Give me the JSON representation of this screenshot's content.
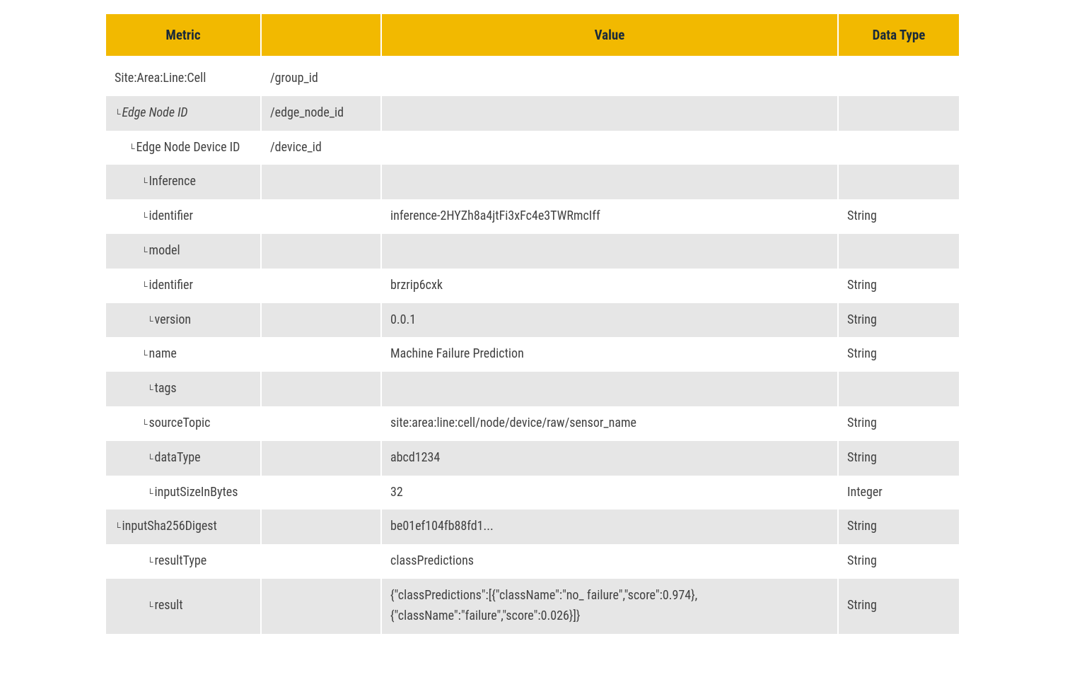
{
  "headers": {
    "metric": "Metric",
    "path": "",
    "value": "Value",
    "datatype": "Data Type"
  },
  "rows": [
    {
      "metric": "Site:Area:Line:Cell",
      "indent": 0,
      "tree": false,
      "italic": false,
      "path": "/group_id",
      "value": "",
      "datatype": "",
      "parity": "odd"
    },
    {
      "metric": "Edge Node ID",
      "indent": 1,
      "tree": true,
      "italic": true,
      "path": "/edge_node_id",
      "value": "",
      "datatype": "",
      "parity": "even"
    },
    {
      "metric": "Edge Node Device ID",
      "indent": 2,
      "tree": true,
      "italic": false,
      "path": "/device_id",
      "value": "",
      "datatype": "",
      "parity": "odd"
    },
    {
      "metric": "Inference",
      "indent": 3,
      "tree": true,
      "italic": false,
      "path": "",
      "value": "",
      "datatype": "",
      "parity": "even"
    },
    {
      "metric": "identifier",
      "indent": 3,
      "tree": true,
      "italic": false,
      "path": "",
      "value": "inference-2HYZh8a4jtFi3xFc4e3TWRmcIff",
      "datatype": "String",
      "parity": "odd"
    },
    {
      "metric": "model",
      "indent": 3,
      "tree": true,
      "italic": false,
      "path": "",
      "value": "",
      "datatype": "",
      "parity": "even"
    },
    {
      "metric": "identifier",
      "indent": 3,
      "tree": true,
      "italic": false,
      "path": "",
      "value": "brzrip6cxk",
      "datatype": "String",
      "parity": "odd"
    },
    {
      "metric": "version",
      "indent": 4,
      "tree": true,
      "italic": false,
      "path": "",
      "value": "0.0.1",
      "datatype": "String",
      "parity": "even"
    },
    {
      "metric": "name",
      "indent": 3,
      "tree": true,
      "italic": false,
      "path": "",
      "value": "Machine Failure Prediction",
      "datatype": "String",
      "parity": "odd"
    },
    {
      "metric": "tags",
      "indent": 4,
      "tree": true,
      "italic": false,
      "path": "",
      "value": "",
      "datatype": "",
      "parity": "even"
    },
    {
      "metric": "sourceTopic",
      "indent": 3,
      "tree": true,
      "italic": false,
      "path": "",
      "value": "site:area:line:cell/node/device/raw/sensor_name",
      "datatype": "String",
      "parity": "odd"
    },
    {
      "metric": "dataType",
      "indent": 4,
      "tree": true,
      "italic": false,
      "path": "",
      "value": "abcd1234",
      "datatype": "String",
      "parity": "even"
    },
    {
      "metric": "inputSizeInBytes",
      "indent": 4,
      "tree": true,
      "italic": false,
      "path": "",
      "value": "32",
      "datatype": "Integer",
      "parity": "odd"
    },
    {
      "metric": "inputSha256Digest",
      "indent": 1,
      "tree": true,
      "italic": false,
      "path": "",
      "value": "be01ef104fb88fd1...",
      "datatype": "String",
      "parity": "even"
    },
    {
      "metric": "resultType",
      "indent": 4,
      "tree": true,
      "italic": false,
      "path": "",
      "value": "classPredictions",
      "datatype": "String",
      "parity": "odd"
    },
    {
      "metric": "result",
      "indent": 4,
      "tree": true,
      "italic": false,
      "path": "",
      "value": "{\"classPredictions\":[{\"className\":\"no_ failure\",\"score\":0.974},{\"className\":\"failure\",\"score\":0.026}]}",
      "datatype": "String",
      "parity": "even"
    }
  ]
}
